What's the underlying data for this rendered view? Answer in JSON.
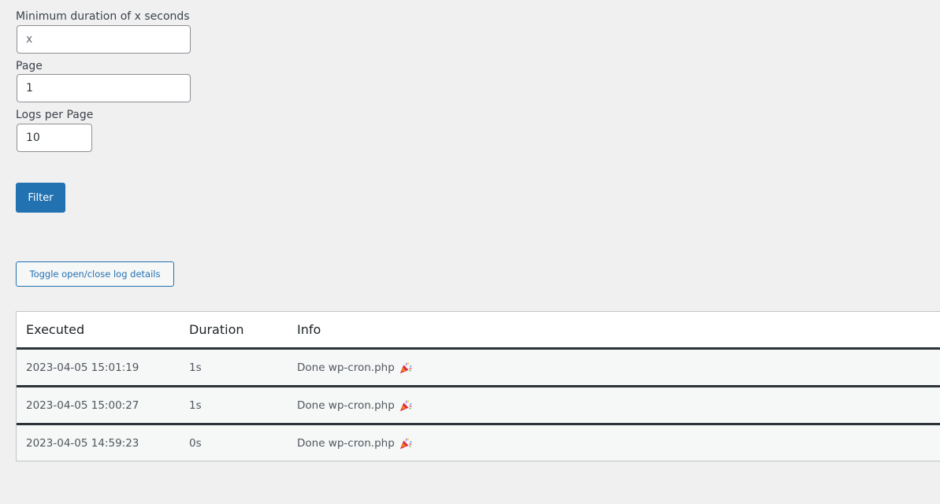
{
  "form": {
    "min_duration": {
      "label": "Minimum duration of x seconds",
      "value": "",
      "placeholder": "x"
    },
    "page": {
      "label": "Page",
      "value": "1"
    },
    "logs_per_page": {
      "label": "Logs per Page",
      "value": "10"
    },
    "filter_label": "Filter"
  },
  "toggle_label": "Toggle open/close log details",
  "table": {
    "headers": {
      "executed": "Executed",
      "duration": "Duration",
      "info": "Info"
    },
    "rows": [
      {
        "executed": "2023-04-05 15:01:19",
        "duration": "1s",
        "info": "Done wp-cron.php",
        "icon": "party-popper-icon"
      },
      {
        "executed": "2023-04-05 15:00:27",
        "duration": "1s",
        "info": "Done wp-cron.php",
        "icon": "party-popper-icon"
      },
      {
        "executed": "2023-04-05 14:59:23",
        "duration": "0s",
        "info": "Done wp-cron.php",
        "icon": "party-popper-icon"
      }
    ]
  },
  "colors": {
    "background": "#f0f0f1",
    "accent": "#2271b1",
    "row_background": "#f6f7f7",
    "row_separator": "#2c3338"
  }
}
